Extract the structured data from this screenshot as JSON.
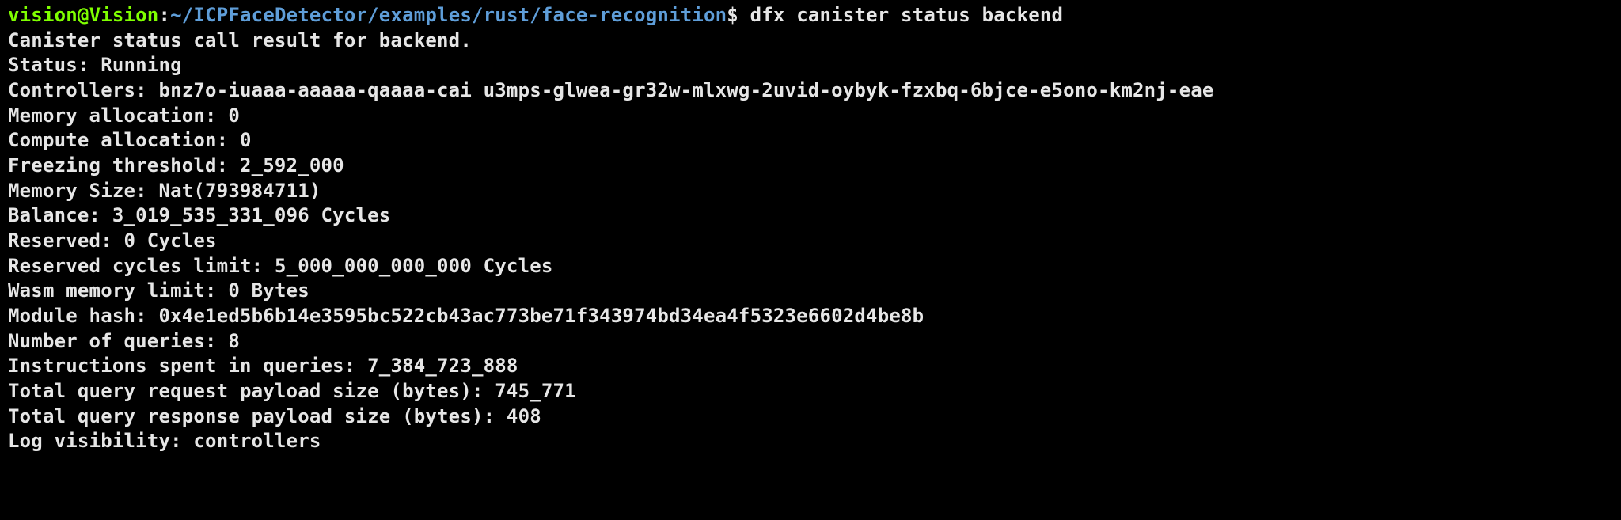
{
  "prompt": {
    "user": "vision",
    "at": "@",
    "host": "Vision",
    "colon": ":",
    "path": "~/ICPFaceDetector/examples/rust/face-recognition",
    "dollar": "$",
    "command": "dfx canister status backend"
  },
  "output": {
    "result_header": "Canister status call result for backend.",
    "status_label": "Status: ",
    "status_value": "Running",
    "controllers_label": "Controllers: ",
    "controllers_value": "bnz7o-iuaaa-aaaaa-qaaaa-cai u3mps-glwea-gr32w-mlxwg-2uvid-oybyk-fzxbq-6bjce-e5ono-km2nj-eae",
    "memory_alloc_label": "Memory allocation: ",
    "memory_alloc_value": "0",
    "compute_alloc_label": "Compute allocation: ",
    "compute_alloc_value": "0",
    "freezing_label": "Freezing threshold: ",
    "freezing_value": "2_592_000",
    "memory_size_label": "Memory Size: ",
    "memory_size_value": "Nat(793984711)",
    "balance_label": "Balance: ",
    "balance_value": "3_019_535_331_096 Cycles",
    "reserved_label": "Reserved: ",
    "reserved_value": "0 Cycles",
    "reserved_limit_label": "Reserved cycles limit: ",
    "reserved_limit_value": "5_000_000_000_000 Cycles",
    "wasm_limit_label": "Wasm memory limit: ",
    "wasm_limit_value": "0 Bytes",
    "module_hash_label": "Module hash: ",
    "module_hash_value": "0x4e1ed5b6b14e3595bc522cb43ac773be71f343974bd34ea4f5323e6602d4be8b",
    "num_queries_label": "Number of queries: ",
    "num_queries_value": "8",
    "instr_queries_label": "Instructions spent in queries: ",
    "instr_queries_value": "7_384_723_888",
    "total_req_label": "Total query request payload size (bytes): ",
    "total_req_value": "745_771",
    "total_resp_label": "Total query response payload size (bytes): ",
    "total_resp_value": "408",
    "log_vis_label": "Log visibility: ",
    "log_vis_value": "controllers"
  }
}
